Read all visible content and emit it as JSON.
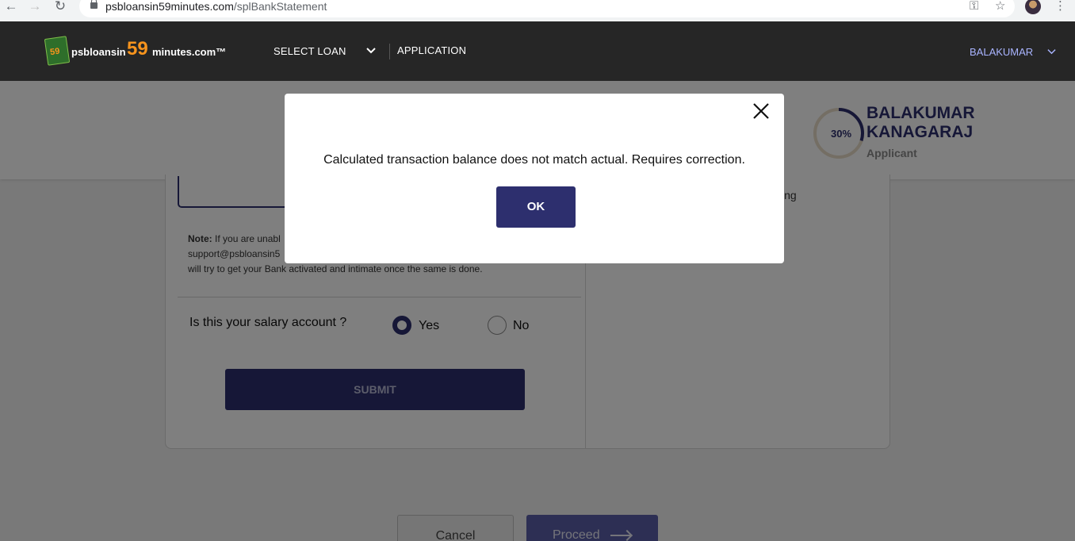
{
  "browser": {
    "url_domain": "psbloansin59minutes.com",
    "url_path": "/splBankStatement"
  },
  "header": {
    "logo_badge": "59",
    "logo_text_left": "psbloansin",
    "logo_number": "59",
    "logo_text_right": "minutes.com™",
    "nav_select_loan": "SELECT LOAN",
    "nav_application": "APPLICATION",
    "user_name": "BALAKUMAR"
  },
  "applicant": {
    "progress_percent": 30,
    "progress_label": "30%",
    "name_line1": "BALAKUMAR",
    "name_line2": "KANAGARAJ",
    "role": "Applicant"
  },
  "form": {
    "right_snippet": "ing",
    "note_label": "Note:",
    "note_line1": "If you are unabl",
    "note_line2": "support@psbloansin5",
    "note_line3": "will try to get your Bank activated and intimate once the same is done.",
    "salary_question": "Is this your salary account ?",
    "option_yes": "Yes",
    "option_no": "No",
    "selected_option": "Yes",
    "submit_label": "SUBMIT",
    "cancel_label": "Cancel",
    "proceed_label": "Proceed"
  },
  "modal": {
    "message": "Calculated transaction balance does not match actual. Requires correction.",
    "ok_label": "OK"
  },
  "colors": {
    "primary": "#2d2f6e",
    "accent": "#f7941d",
    "header_bg": "#262626"
  }
}
